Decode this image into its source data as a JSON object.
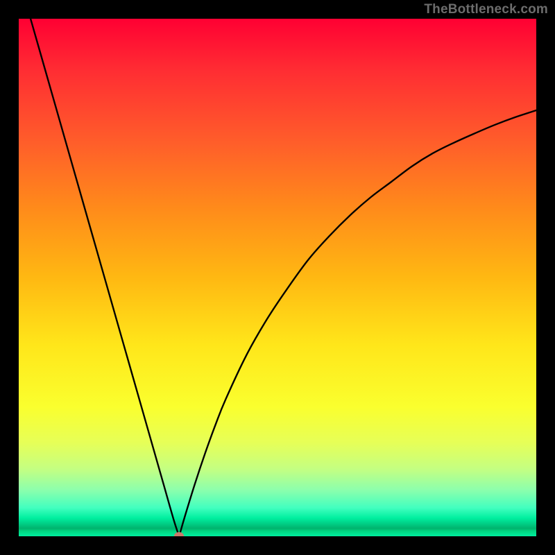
{
  "attribution": "TheBottleneck.com",
  "chart_data": {
    "type": "line",
    "title": "",
    "xlabel": "",
    "ylabel": "",
    "xlim": [
      0,
      100
    ],
    "ylim": [
      0,
      100
    ],
    "x": [
      0,
      2,
      4,
      6,
      8,
      10,
      12,
      14,
      16,
      18,
      20,
      22,
      24,
      26,
      28,
      30,
      31,
      32,
      34,
      36,
      38,
      40,
      44,
      48,
      52,
      56,
      60,
      64,
      68,
      72,
      76,
      80,
      84,
      88,
      92,
      96,
      100
    ],
    "values": [
      108,
      101,
      94,
      87,
      80,
      73,
      66,
      59,
      52,
      45,
      38,
      31,
      24,
      17,
      10,
      3,
      0,
      3.5,
      10,
      16,
      21.5,
      26.5,
      35,
      42,
      48,
      53.5,
      58,
      62,
      65.5,
      68.5,
      71.5,
      74,
      76,
      77.8,
      79.5,
      81,
      82.3
    ],
    "marker": {
      "x": 31,
      "y": 0,
      "color": "#c97a6a"
    },
    "gradient_stops": [
      {
        "pos": 0,
        "color": "#ff0033"
      },
      {
        "pos": 50,
        "color": "#ffe61a"
      },
      {
        "pos": 95,
        "color": "#42ffbf"
      },
      {
        "pos": 100,
        "color": "#00ef9f"
      }
    ]
  }
}
